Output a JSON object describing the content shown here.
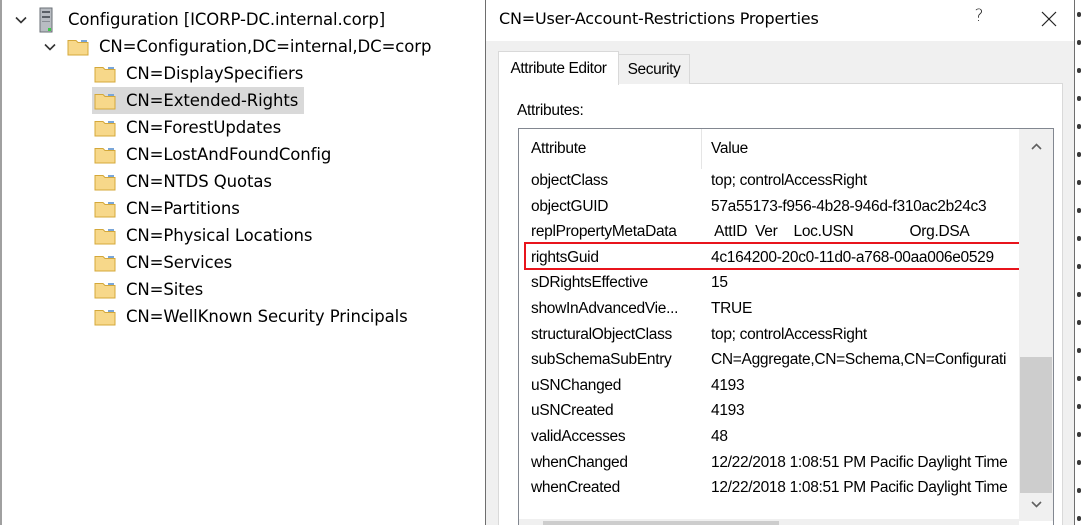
{
  "tree": {
    "root": {
      "label": "Configuration [ICORP-DC.internal.corp]",
      "icon": "server-icon",
      "expanded": true
    },
    "container": {
      "label": "CN=Configuration,DC=internal,DC=corp",
      "icon": "folder-icon",
      "expanded": true
    },
    "children": [
      {
        "label": "CN=DisplaySpecifiers",
        "selected": false
      },
      {
        "label": "CN=Extended-Rights",
        "selected": true
      },
      {
        "label": "CN=ForestUpdates",
        "selected": false
      },
      {
        "label": "CN=LostAndFoundConfig",
        "selected": false
      },
      {
        "label": "CN=NTDS Quotas",
        "selected": false
      },
      {
        "label": "CN=Partitions",
        "selected": false
      },
      {
        "label": "CN=Physical Locations",
        "selected": false
      },
      {
        "label": "CN=Services",
        "selected": false
      },
      {
        "label": "CN=Sites",
        "selected": false
      },
      {
        "label": "CN=WellKnown Security Principals",
        "selected": false
      }
    ]
  },
  "dialog": {
    "title": "CN=User-Account-Restrictions Properties",
    "help_label": "?",
    "close_icon": "close-icon",
    "tabs": [
      {
        "label": "Attribute Editor",
        "active": true
      },
      {
        "label": "Security",
        "active": false
      }
    ],
    "attributes_label": "Attributes:",
    "columns": {
      "attribute": "Attribute",
      "value": "Value"
    },
    "rows": [
      {
        "attribute": "objectClass",
        "value": "top; controlAccessRight"
      },
      {
        "attribute": "objectGUID",
        "value": "57a55173-f956-4b28-946d-f310ac2b24c3"
      },
      {
        "attribute": "replPropertyMetaData",
        "value": " AttID  Ver    Loc.USN              Org.DSA"
      },
      {
        "attribute": "rightsGuid",
        "value": "4c164200-20c0-11d0-a768-00aa006e0529",
        "highlighted": true
      },
      {
        "attribute": "sDRightsEffective",
        "value": "15"
      },
      {
        "attribute": "showInAdvancedVie...",
        "value": "TRUE"
      },
      {
        "attribute": "structuralObjectClass",
        "value": "top; controlAccessRight"
      },
      {
        "attribute": "subSchemaSubEntry",
        "value": "CN=Aggregate,CN=Schema,CN=Configurati"
      },
      {
        "attribute": "uSNChanged",
        "value": "4193"
      },
      {
        "attribute": "uSNCreated",
        "value": "4193"
      },
      {
        "attribute": "validAccesses",
        "value": "48"
      },
      {
        "attribute": "whenChanged",
        "value": "12/22/2018 1:08:51 PM Pacific Daylight Time"
      },
      {
        "attribute": "whenCreated",
        "value": "12/22/2018 1:08:51 PM Pacific Daylight Time"
      }
    ],
    "highlight_color": "#e8141c"
  }
}
